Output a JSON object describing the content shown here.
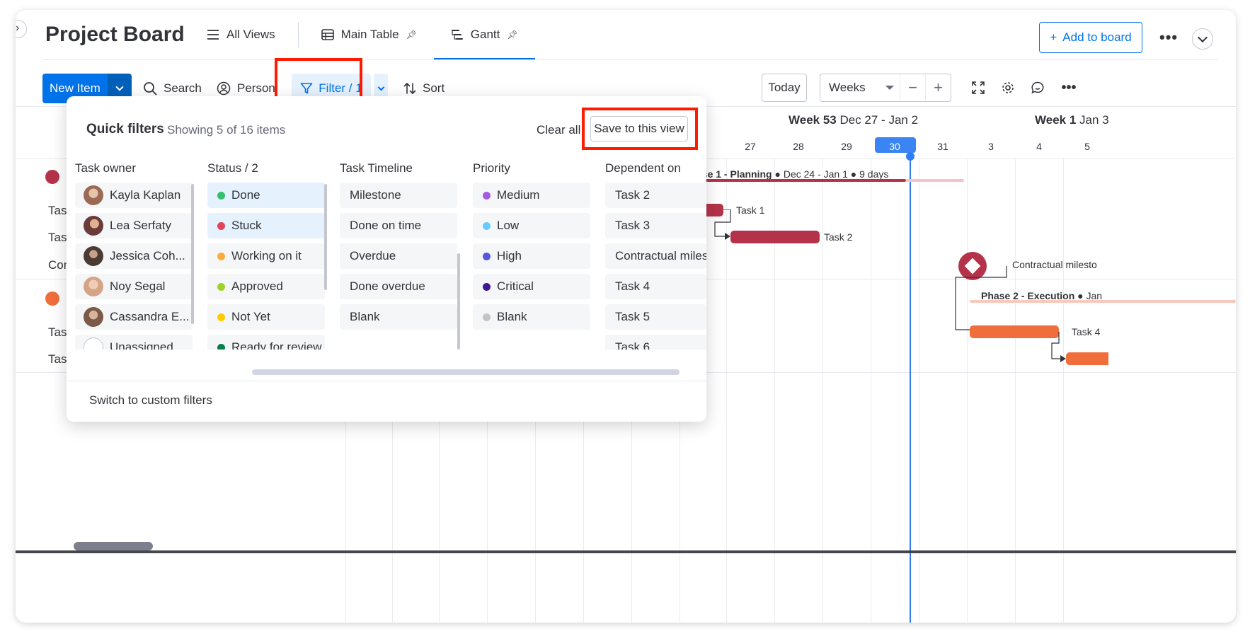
{
  "board": {
    "title": "Project Board",
    "views": [
      {
        "label": "All Views",
        "icon": "menu-icon"
      },
      {
        "label": "Main Table",
        "icon": "table-icon",
        "pinned": true
      },
      {
        "label": "Gantt",
        "icon": "gantt-icon",
        "pinned": true,
        "active": true
      }
    ],
    "add_to_board": "Add to board"
  },
  "toolbar": {
    "new_item": "New Item",
    "search": "Search",
    "person": "Person",
    "filter": "Filter / 1",
    "sort": "Sort",
    "today": "Today",
    "zoom": "Weeks",
    "zoom_out": "−",
    "zoom_in": "+"
  },
  "gantt": {
    "weeks": [
      {
        "name": "Week 53",
        "range": "Dec 27 - Jan 2"
      },
      {
        "name": "Week 1",
        "range": "Jan 3"
      }
    ],
    "days": [
      "4",
      "27",
      "28",
      "29",
      "30",
      "31",
      "3",
      "4",
      "5"
    ],
    "today_day": "30",
    "row_labels": [
      "Tas",
      "Tas",
      "Con",
      "Tas",
      "Tas"
    ],
    "phase1": {
      "name": "ase 1 - Planning",
      "detail": "● Dec 24 - Jan 1 ● 9 days",
      "color": "#b5334a"
    },
    "phase2": {
      "name": "Phase 2 - Execution",
      "detail": "● Jan",
      "color": "#f06d3c"
    },
    "tasks": [
      {
        "label": "Task 1"
      },
      {
        "label": "Task 2"
      },
      {
        "label": "Contractual milesto"
      },
      {
        "label": "Task 4"
      }
    ]
  },
  "quick_filters": {
    "title": "Quick filters",
    "count": "Showing 5 of 16 items",
    "clear_all": "Clear all",
    "save": "Save to this view",
    "switch_custom": "Switch to custom filters",
    "columns": [
      {
        "header": "Task owner",
        "options": [
          {
            "label": "Kayla Kaplan",
            "avatar": "#9a6a55"
          },
          {
            "label": "Lea Serfaty",
            "avatar": "#6b3a3a"
          },
          {
            "label": "Jessica Coh...",
            "avatar": "#4a3b33"
          },
          {
            "label": "Noy Segal",
            "avatar": "#d4a488"
          },
          {
            "label": "Cassandra E...",
            "avatar": "#7b5a48"
          },
          {
            "label": "Unassigned",
            "avatar": "none"
          }
        ]
      },
      {
        "header": "Status / 2",
        "options": [
          {
            "label": "Done",
            "color": "#33c26b",
            "selected": true
          },
          {
            "label": "Stuck",
            "color": "#e2445c",
            "selected": true
          },
          {
            "label": "Working on it",
            "color": "#fdab3d"
          },
          {
            "label": "Approved",
            "color": "#9cd326"
          },
          {
            "label": "Not Yet",
            "color": "#ffcb00"
          },
          {
            "label": "Ready for review",
            "color": "#037f4c"
          }
        ]
      },
      {
        "header": "Task Timeline",
        "options": [
          {
            "label": "Milestone"
          },
          {
            "label": "Done on time"
          },
          {
            "label": "Overdue"
          },
          {
            "label": "Done overdue"
          },
          {
            "label": "Blank"
          }
        ]
      },
      {
        "header": "Priority",
        "options": [
          {
            "label": "Medium",
            "color": "#a25ddc"
          },
          {
            "label": "Low",
            "color": "#66ccff"
          },
          {
            "label": "High",
            "color": "#5559df"
          },
          {
            "label": "Critical",
            "color": "#401694"
          },
          {
            "label": "Blank",
            "color": "#c4c4c4"
          }
        ]
      },
      {
        "header": "Dependent on",
        "options": [
          {
            "label": "Task 2"
          },
          {
            "label": "Task 3"
          },
          {
            "label": "Contractual milest..."
          },
          {
            "label": "Task 4"
          },
          {
            "label": "Task 5"
          },
          {
            "label": "Task 6"
          }
        ]
      }
    ]
  },
  "colors": {
    "accent": "#0073ea",
    "highlight": "#ff1a00",
    "today": "#2f7df6"
  }
}
